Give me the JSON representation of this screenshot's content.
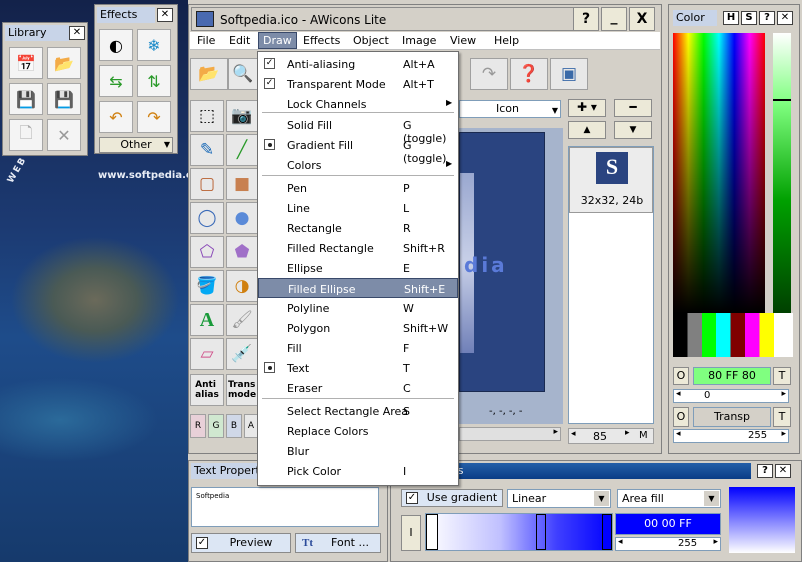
{
  "library": {
    "title": "Library"
  },
  "effects": {
    "title": "Effects",
    "other_label": "Other"
  },
  "desktop": {
    "url": "www.softpedia.com",
    "web_text": "WEB ENT"
  },
  "window": {
    "title": "Softpedia.ico - AWicons Lite",
    "help": "?",
    "min": "_",
    "close": "X"
  },
  "menus": [
    "File",
    "Edit",
    "Draw",
    "Effects",
    "Object",
    "Image",
    "View",
    "Help"
  ],
  "draw_menu": [
    {
      "label": "Anti-aliasing",
      "shortcut": "Alt+A",
      "mark": "check"
    },
    {
      "label": "Transparent Mode",
      "shortcut": "Alt+T",
      "mark": "check"
    },
    {
      "label": "Lock Channels",
      "shortcut": "",
      "mark": "",
      "submenu": true
    },
    {
      "label": "Solid Fill",
      "shortcut": "G (toggle)",
      "mark": ""
    },
    {
      "label": "Gradient Fill",
      "shortcut": "G (toggle)",
      "mark": "radio"
    },
    {
      "label": "Colors",
      "shortcut": "",
      "mark": "",
      "submenu": true
    },
    {
      "label": "Pen",
      "shortcut": "P",
      "mark": ""
    },
    {
      "label": "Line",
      "shortcut": "L",
      "mark": ""
    },
    {
      "label": "Rectangle",
      "shortcut": "R",
      "mark": ""
    },
    {
      "label": "Filled Rectangle",
      "shortcut": "Shift+R",
      "mark": ""
    },
    {
      "label": "Ellipse",
      "shortcut": "E",
      "mark": ""
    },
    {
      "label": "Filled Ellipse",
      "shortcut": "Shift+E",
      "mark": "",
      "selected": true
    },
    {
      "label": "Polyline",
      "shortcut": "W",
      "mark": ""
    },
    {
      "label": "Polygon",
      "shortcut": "Shift+W",
      "mark": ""
    },
    {
      "label": "Fill",
      "shortcut": "F",
      "mark": ""
    },
    {
      "label": "Text",
      "shortcut": "T",
      "mark": "radio"
    },
    {
      "label": "Eraser",
      "shortcut": "C",
      "mark": ""
    },
    {
      "label": "Select Rectangle Area",
      "shortcut": "S",
      "mark": ""
    },
    {
      "label": "Replace Colors",
      "shortcut": "",
      "mark": ""
    },
    {
      "label": "Blur",
      "shortcut": "",
      "mark": ""
    },
    {
      "label": "Pick Color",
      "shortcut": "I",
      "mark": ""
    }
  ],
  "tools": {
    "anti_alias": "Anti\nalias",
    "transp_mode": "Trans\nmode",
    "channels": [
      "R",
      "G",
      "B",
      "A"
    ]
  },
  "canvas": {
    "view_mode": "Icon",
    "coords": "-, -, -, -",
    "zoom": "85",
    "m_label": "M"
  },
  "thumbnail": {
    "letter": "S",
    "info": "32x32, 24b"
  },
  "color_panel": {
    "title": "Color",
    "btn_h": "H",
    "btn_s": "S",
    "btn_help": "?",
    "o_label": "O",
    "color_value": "80 FF 80",
    "t_label": "T",
    "alpha_value": "0",
    "transp_label": "Transp",
    "opacity_value": "255"
  },
  "text_props": {
    "title": "Text Properties",
    "preview_text": "Softpedia",
    "preview_label": "Preview",
    "font_label": "Font ..."
  },
  "fill_panel": {
    "title_suffix": "es",
    "use_gradient": "Use gradient",
    "gradient_type": "Linear",
    "fill_mode": "Area fill",
    "i_label": "I",
    "color_hex": "00 00 FF",
    "alpha": "255"
  },
  "colors": {
    "titlebar": "#0a3d86",
    "accent": "#80ff80",
    "selected": "#7d8ca8"
  }
}
